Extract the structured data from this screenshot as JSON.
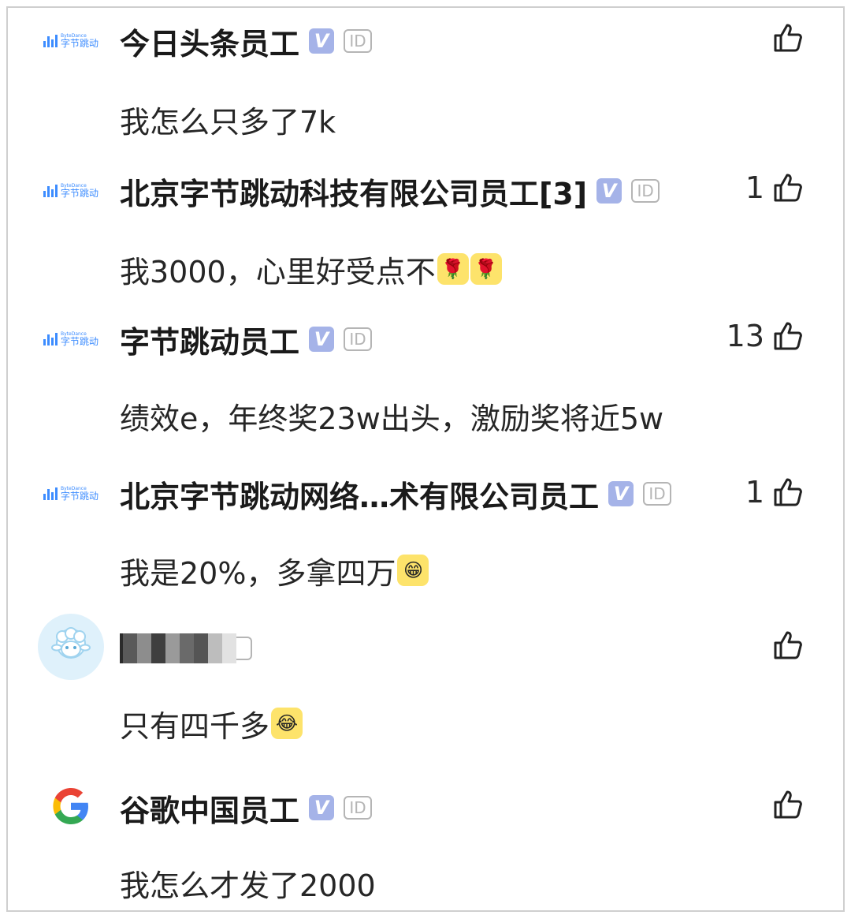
{
  "comments": [
    {
      "name": "今日头条员工",
      "likes": "",
      "text": "我怎么只多了7k",
      "avatar": "bytedance-logo",
      "logo_small": "ByteDance",
      "logo_cn": "字节跳动",
      "emojis": []
    },
    {
      "name": "北京字节跳动科技有限公司员工[3]",
      "likes": "1",
      "text": "我3000，心里好受点不",
      "avatar": "bytedance-logo",
      "logo_small": "ByteDance",
      "logo_cn": "字节跳动",
      "emojis": [
        "rose-emoji",
        "rose-emoji"
      ]
    },
    {
      "name": "字节跳动员工",
      "likes": "13",
      "text": "绩效e，年终奖23w出头，激励奖将近5w",
      "avatar": "bytedance-logo",
      "logo_small": "ByteDance",
      "logo_cn": "字节跳动",
      "emojis": []
    },
    {
      "name": "北京字节跳动网络…术有限公司员工",
      "likes": "1",
      "text": "我是20%，多拿四万",
      "avatar": "bytedance-logo",
      "logo_small": "ByteDance",
      "logo_cn": "字节跳动",
      "emojis": [
        "grin-emoji"
      ]
    },
    {
      "name": "",
      "likes": "",
      "text": "只有四千多",
      "avatar": "sheep-avatar",
      "emojis": [
        "laugh-cry-emoji"
      ]
    },
    {
      "name": "谷歌中国员工",
      "likes": "",
      "text": "我怎么才发了2000",
      "avatar": "google-logo",
      "emojis": []
    }
  ],
  "badges": {
    "verified": "V",
    "id": "ID"
  },
  "icons": {
    "like": "thumb-up-icon"
  },
  "colors": {
    "verified_badge": "#a5b3e8",
    "bytedance_blue": "#3c8cff"
  }
}
